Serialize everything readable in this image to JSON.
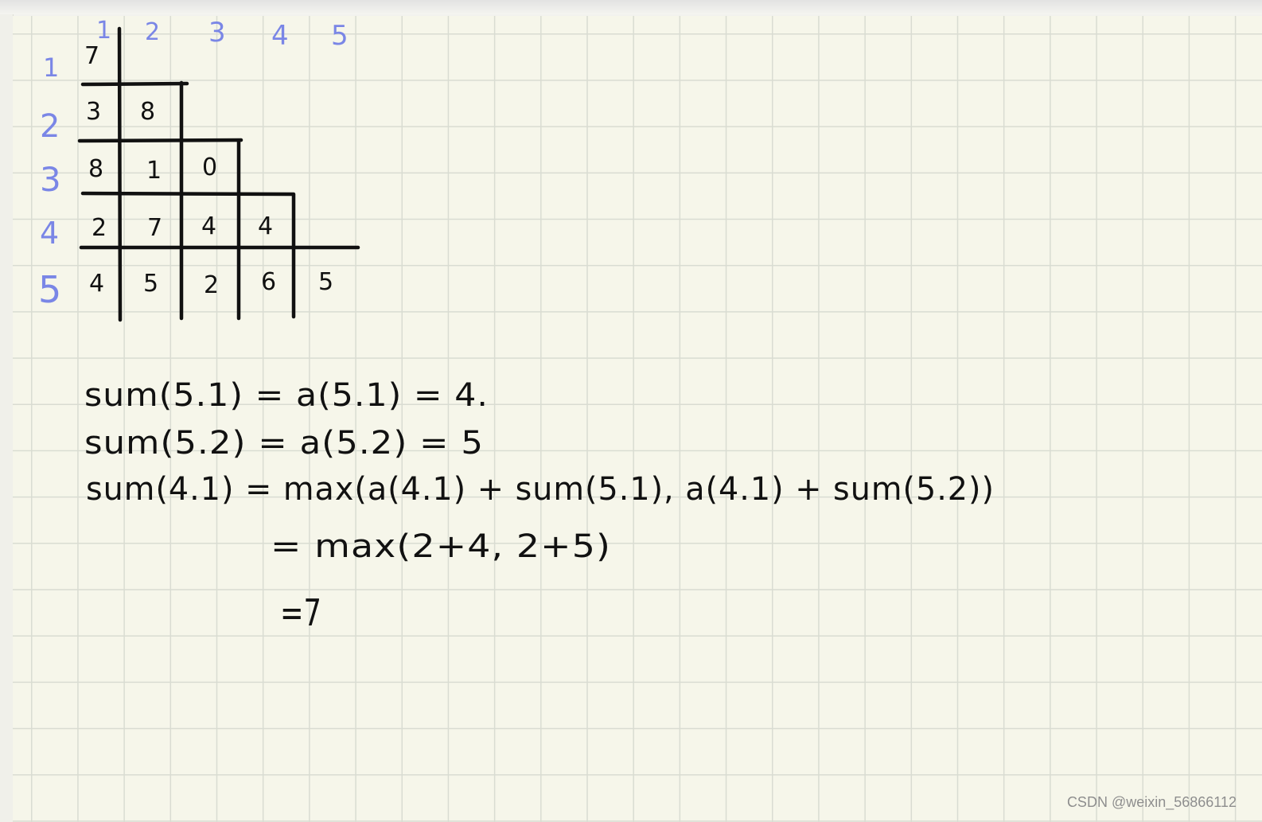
{
  "column_labels": [
    "1",
    "2",
    "3",
    "4",
    "5"
  ],
  "row_labels": [
    "1",
    "2",
    "3",
    "4",
    "5"
  ],
  "triangle": [
    [
      "7"
    ],
    [
      "3",
      "8"
    ],
    [
      "8",
      "1",
      "0"
    ],
    [
      "2",
      "7",
      "4",
      "4"
    ],
    [
      "4",
      "5",
      "2",
      "6",
      "5"
    ]
  ],
  "equations": [
    "sum(5.1) = a(5.1) = 4.",
    "sum(5.2) = a(5.2) = 5",
    "sum(4.1) = max(a(4.1) + sum(5.1), a(4.1) + sum(5.2))",
    "= max(2+4, 2+5)",
    "=7"
  ],
  "watermark": "CSDN @weixin_56866112",
  "colors": {
    "ink": "#111111",
    "index_ink": "#7a86e6",
    "paper": "#f6f6ea",
    "grid": "#d9dcd2"
  }
}
